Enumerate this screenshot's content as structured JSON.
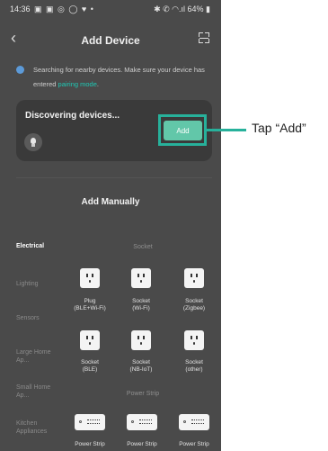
{
  "status_bar": {
    "time": "14:36",
    "left_icons": "▣ ▣ ◎ ◯ ♥ •",
    "right_icons": "✱ ✆ ◠.ıl",
    "battery": "64%"
  },
  "header": {
    "title": "Add Device"
  },
  "searching": {
    "text": "Searching for nearby devices. Make sure your device has entered ",
    "link": "pairing mode",
    "suffix": "."
  },
  "discovering": {
    "title": "Discovering devices...",
    "add_button": "Add"
  },
  "add_manually": {
    "title": "Add Manually"
  },
  "categories": [
    "Electrical",
    "Lighting",
    "Sensors",
    "Large Home Ap...",
    "Small Home Ap...",
    "Kitchen Appliances"
  ],
  "groups": {
    "socket": "Socket",
    "power_strip": "Power Strip"
  },
  "devices": [
    {
      "line1": "Plug",
      "line2": "(BLE+Wi-Fi)"
    },
    {
      "line1": "Socket",
      "line2": "(Wi-Fi)"
    },
    {
      "line1": "Socket",
      "line2": "(Zigbee)"
    },
    {
      "line1": "Socket",
      "line2": "(BLE)"
    },
    {
      "line1": "Socket",
      "line2": "(NB-IoT)"
    },
    {
      "line1": "Socket",
      "line2": "(other)"
    }
  ],
  "strips": [
    "Power Strip",
    "Power Strip",
    "Power Strip"
  ],
  "annotation": {
    "text": "Tap “Add”",
    "color": "#27b19b"
  }
}
